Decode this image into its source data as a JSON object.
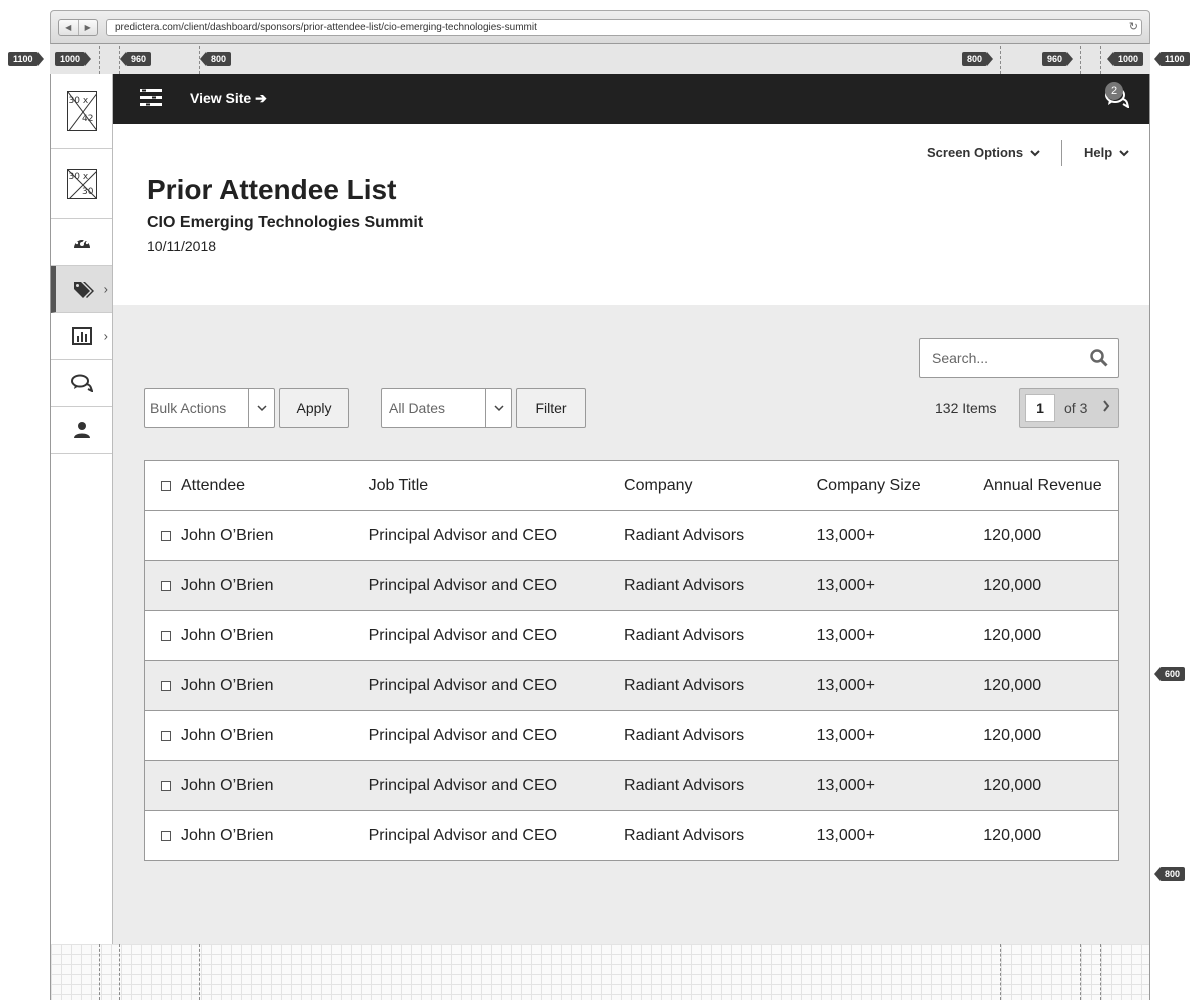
{
  "browser": {
    "url": "predictera.com/client/dashboard/sponsors/prior-attendee-list/cio-emerging-technologies-summit",
    "back": "◀",
    "forward": "▶",
    "reload": "↻"
  },
  "ruler": {
    "tags": [
      "1100",
      "1000",
      "960",
      "800",
      "800",
      "960",
      "1000",
      "1100",
      "600",
      "800"
    ]
  },
  "sidebar": {
    "logo_text_top": "30 x",
    "logo_text_bottom": "42",
    "logo2_text_top": "30 x",
    "logo2_text_bottom": "30",
    "items": [
      {
        "icon": "dashboard-gauge-icon",
        "has_chevron": false
      },
      {
        "icon": "tags-icon",
        "has_chevron": true,
        "active": true
      },
      {
        "icon": "bar-chart-icon",
        "has_chevron": true
      },
      {
        "icon": "chat-icon",
        "has_chevron": false
      },
      {
        "icon": "user-icon",
        "has_chevron": false
      }
    ],
    "chevron": "›"
  },
  "topbar": {
    "view_site": "View Site ➔",
    "chat_badge": "2"
  },
  "header": {
    "screen_options": "Screen Options",
    "help": "Help",
    "title": "Prior Attendee List",
    "subtitle": "CIO Emerging Technologies Summit",
    "date": "10/11/2018"
  },
  "toolbar": {
    "search_placeholder": "Search...",
    "bulk_actions": "Bulk Actions",
    "apply": "Apply",
    "all_dates": "All Dates",
    "filter": "Filter",
    "items_count": "132 Items",
    "current_page": "1",
    "of_pages": "of 3"
  },
  "table": {
    "headers": [
      "Attendee",
      "Job Title",
      "Company",
      "Company Size",
      "Annual Revenue"
    ],
    "rows": [
      [
        "John O’Brien",
        "Principal Advisor and CEO",
        "Radiant Advisors",
        "13,000+",
        "120,000"
      ],
      [
        "John O’Brien",
        "Principal Advisor and CEO",
        "Radiant Advisors",
        "13,000+",
        "120,000"
      ],
      [
        "John O’Brien",
        "Principal Advisor and CEO",
        "Radiant Advisors",
        "13,000+",
        "120,000"
      ],
      [
        "John O’Brien",
        "Principal Advisor and CEO",
        "Radiant Advisors",
        "13,000+",
        "120,000"
      ],
      [
        "John O’Brien",
        "Principal Advisor and CEO",
        "Radiant Advisors",
        "13,000+",
        "120,000"
      ],
      [
        "John O’Brien",
        "Principal Advisor and CEO",
        "Radiant Advisors",
        "13,000+",
        "120,000"
      ],
      [
        "John O’Brien",
        "Principal Advisor and CEO",
        "Radiant Advisors",
        "13,000+",
        "120,000"
      ]
    ]
  },
  "colors": {
    "topbar": "#212121",
    "content_bg": "#ececec",
    "alt_row": "#ececec",
    "badge": "#444444"
  }
}
